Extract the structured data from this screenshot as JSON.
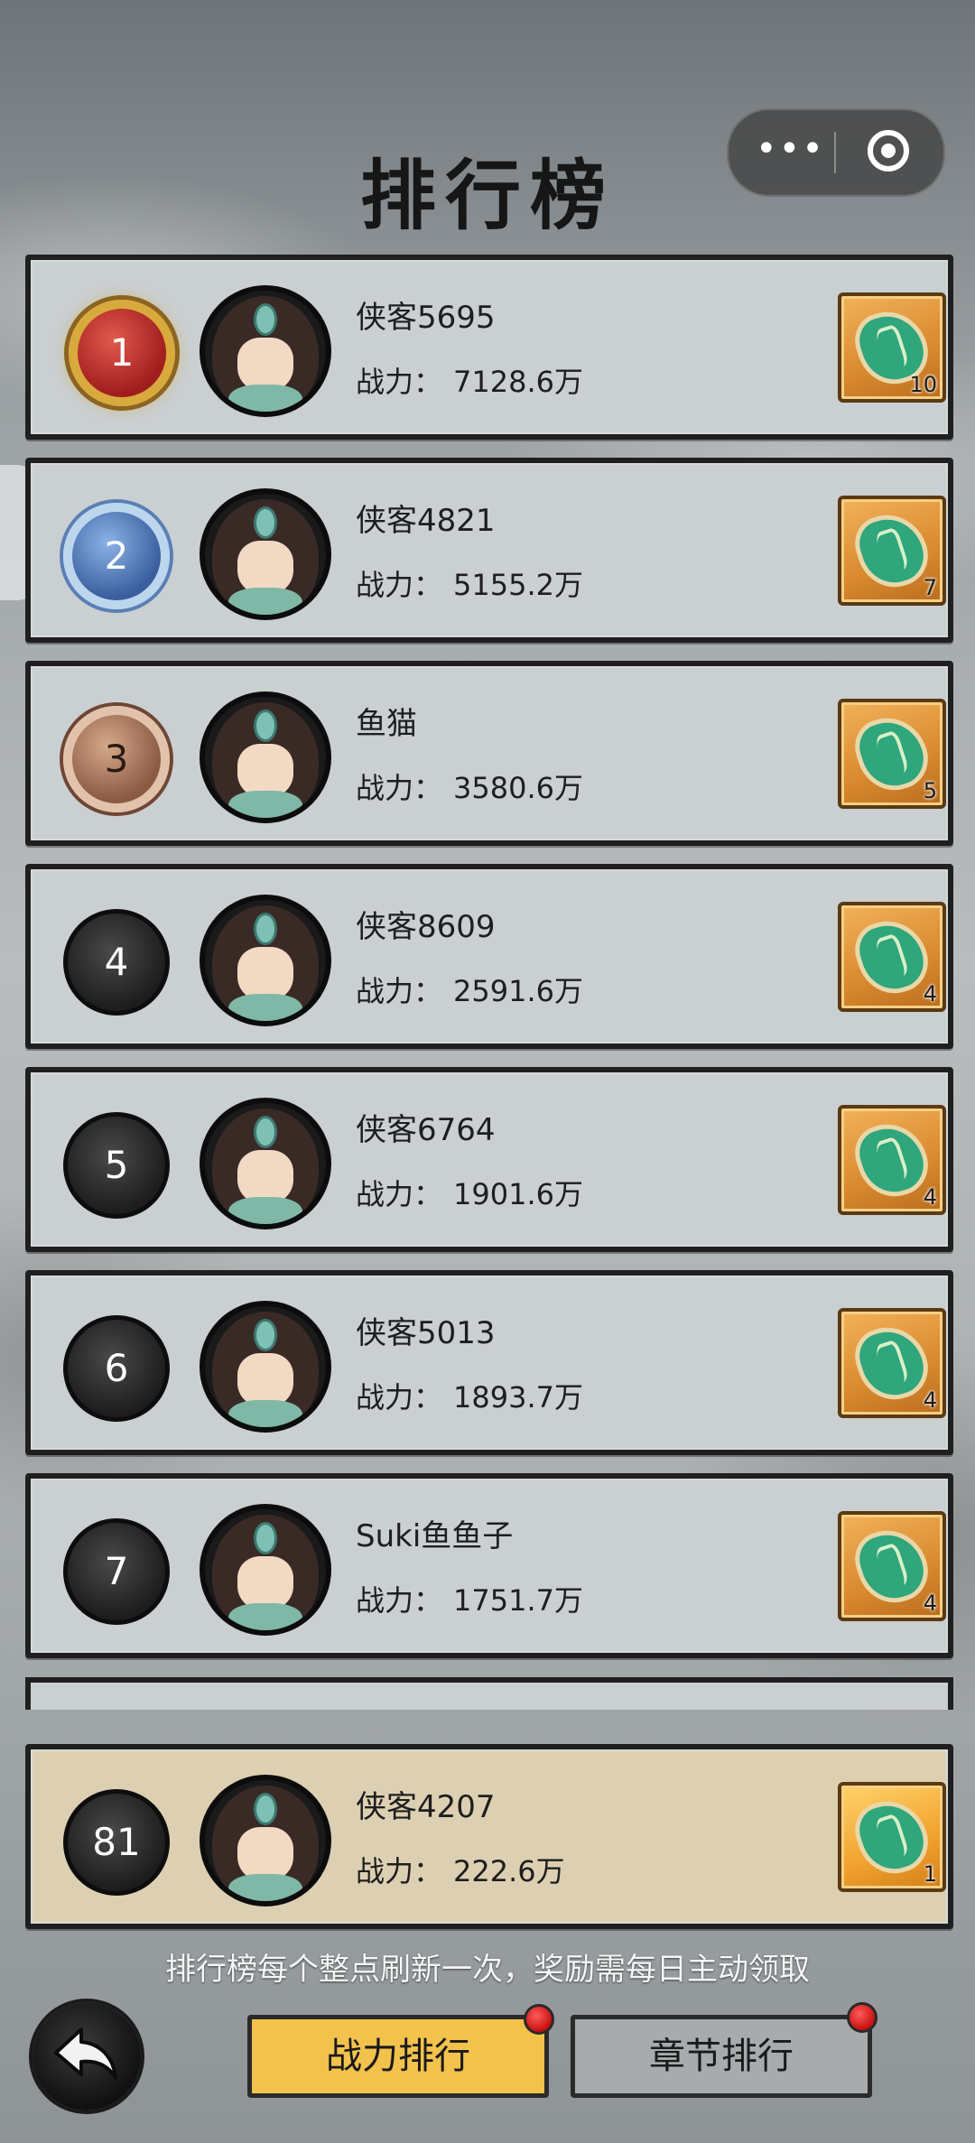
{
  "title": "排行榜",
  "capsule": {
    "more_label": "•••",
    "close_label": ""
  },
  "rows": [
    {
      "rank": "1",
      "name": "侠客5695",
      "power_label": "战力：",
      "power": "7128.6万",
      "reward_count": "10",
      "medal": "gold"
    },
    {
      "rank": "2",
      "name": "侠客4821",
      "power_label": "战力：",
      "power": "5155.2万",
      "reward_count": "7",
      "medal": "silver"
    },
    {
      "rank": "3",
      "name": "鱼猫",
      "power_label": "战力：",
      "power": "3580.6万",
      "reward_count": "5",
      "medal": "bronze"
    },
    {
      "rank": "4",
      "name": "侠客8609",
      "power_label": "战力：",
      "power": "2591.6万",
      "reward_count": "4",
      "medal": "plain"
    },
    {
      "rank": "5",
      "name": "侠客6764",
      "power_label": "战力：",
      "power": "1901.6万",
      "reward_count": "4",
      "medal": "plain"
    },
    {
      "rank": "6",
      "name": "侠客5013",
      "power_label": "战力：",
      "power": "1893.7万",
      "reward_count": "4",
      "medal": "plain"
    },
    {
      "rank": "7",
      "name": "Suki鱼鱼子",
      "power_label": "战力：",
      "power": "1751.7万",
      "reward_count": "4",
      "medal": "plain"
    }
  ],
  "self_row": {
    "rank": "81",
    "name": "侠客4207",
    "power_label": "战力：",
    "power": "222.6万",
    "reward_count": "1"
  },
  "notice": "排行榜每个整点刷新一次，奖励需每日主动领取",
  "tabs": {
    "power_rank": "战力排行",
    "chapter_rank": "章节排行"
  },
  "colors": {
    "active_tab": "#f3c24c",
    "badge_red": "#d91c1c",
    "self_row_bg": "#ddd0b2",
    "row_bg": "#cacfd2"
  },
  "icons": {
    "back": "back-arrow-icon",
    "reward": "jade-token-icon",
    "more": "more-dots-icon",
    "close": "target-close-icon"
  }
}
